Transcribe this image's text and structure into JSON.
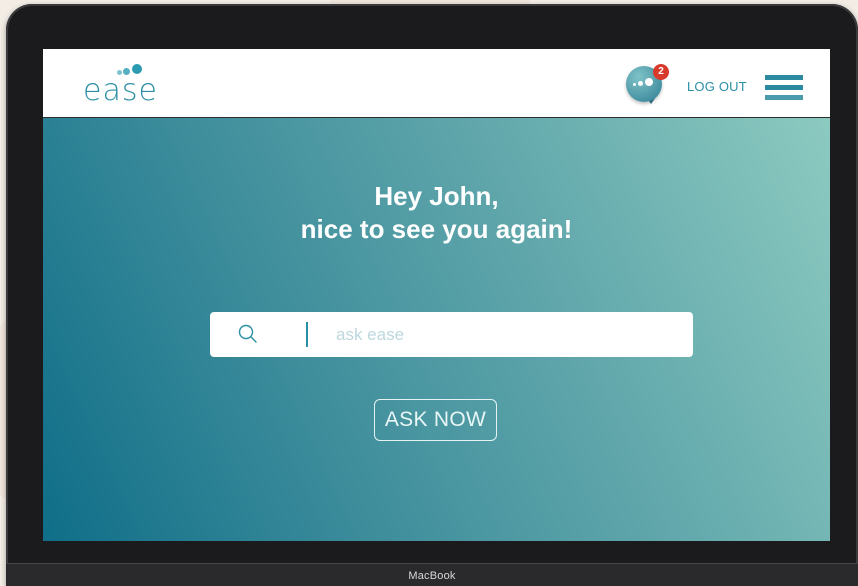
{
  "app": {
    "logo_text": "ease",
    "device_brand": "MacBook"
  },
  "header": {
    "notification_count": "2",
    "logout_label": "LOG OUT",
    "icons": [
      "chat-icon",
      "menu-icon"
    ]
  },
  "hero": {
    "greeting_line1": "Hey John,",
    "greeting_line2": "nice to see you again!",
    "search_placeholder": "ask ease",
    "ask_button_label": "ASK NOW"
  },
  "colors": {
    "accent": "#2b8fa4",
    "badge": "#d83a2c",
    "hero_start": "#0f6e88",
    "hero_end": "#8ccac0"
  }
}
